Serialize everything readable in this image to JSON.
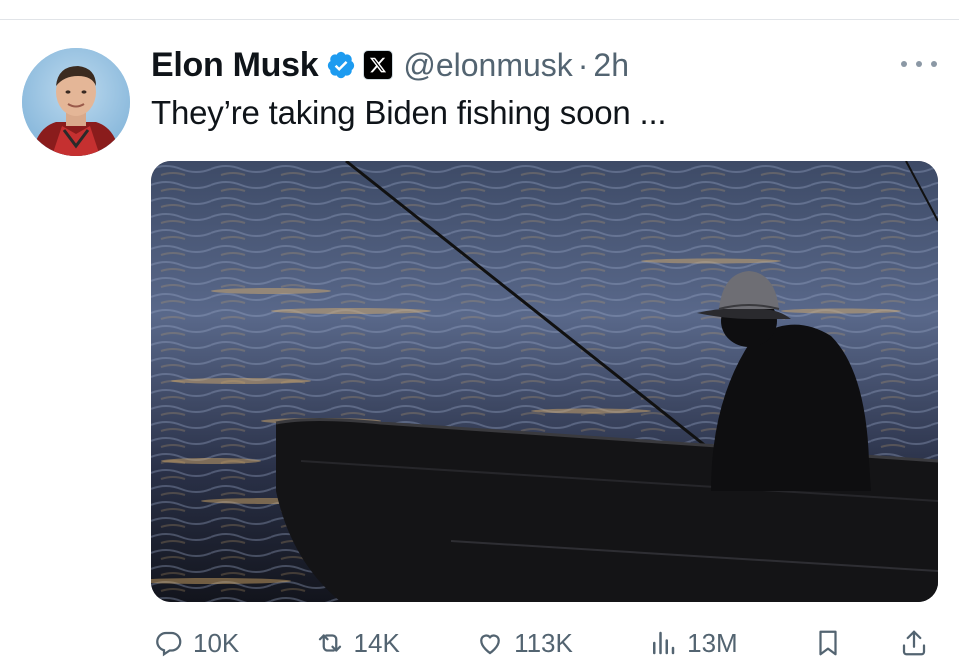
{
  "tweet": {
    "author": {
      "display_name": "Elon Musk",
      "handle": "@elonmusk",
      "verified": true,
      "affiliation_badge": "x-logo-icon"
    },
    "separator": "·",
    "time": "2h",
    "text": "They’re taking Biden fishing soon ...",
    "media": {
      "type": "photo",
      "subject": "silhouette of a person fishing in a small boat on water at dusk"
    },
    "actions": {
      "replies": "10K",
      "reposts": "14K",
      "likes": "113K",
      "views": "13M"
    }
  },
  "colors": {
    "text_primary": "#0f1419",
    "text_secondary": "#536471",
    "verified_blue": "#1d9bf0",
    "divider": "#e1e4e8"
  }
}
